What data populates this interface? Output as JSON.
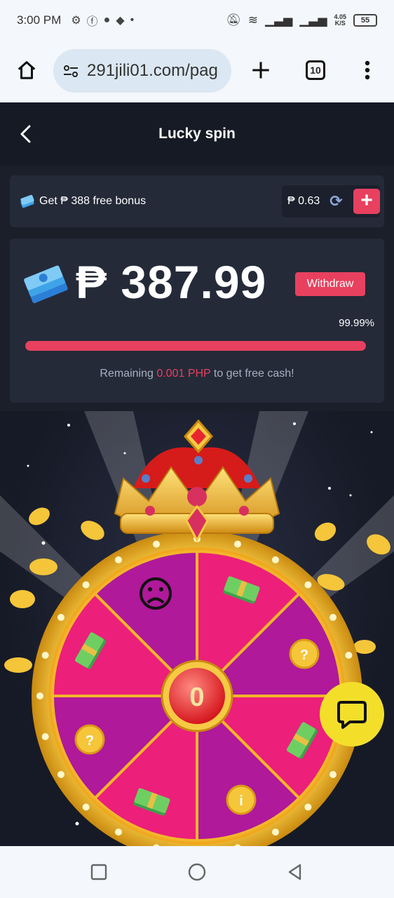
{
  "status_bar": {
    "time": "3:00 PM",
    "net_speed_value": "4.05",
    "net_speed_unit": "K/S",
    "battery": "55"
  },
  "browser": {
    "url": "291jili01.com/pag",
    "tab_count": "10"
  },
  "header": {
    "title": "Lucky spin"
  },
  "bonus_bar": {
    "label": "Get ₱ 388 free bonus",
    "balance": "₱ 0.63",
    "add_label": "+"
  },
  "jackpot": {
    "amount": "₱ 387.99",
    "withdraw_label": "Withdraw",
    "percent_text": "99.99%",
    "progress_fraction": 0.9999,
    "remaining_prefix": "Remaining",
    "remaining_value": "0.001 PHP",
    "remaining_suffix": "to get free cash!"
  },
  "wheel": {
    "center_value": "0",
    "segments": [
      "sad-face",
      "cash",
      "coin",
      "cash",
      "coin",
      "cash",
      "coin",
      "cash"
    ]
  },
  "colors": {
    "accent": "#e8405f",
    "wheel_pink": "#ec1f7a",
    "wheel_magenta": "#b0199a",
    "gold": "#f2b52b",
    "chat_yellow": "#f3df2a"
  }
}
